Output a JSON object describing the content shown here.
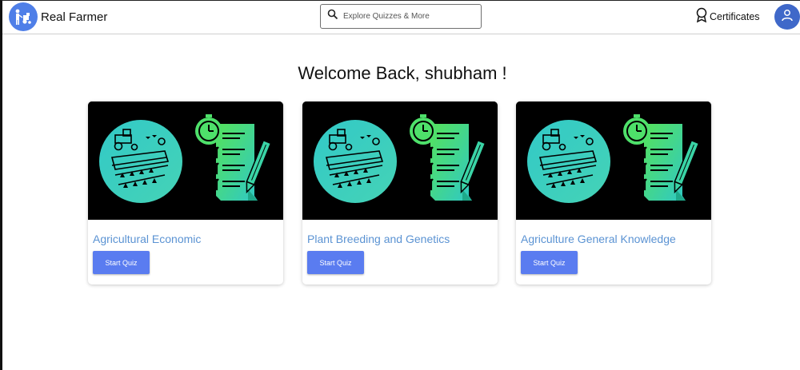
{
  "header": {
    "brand_name": "Real Farmer",
    "search_placeholder": "Explore Quizzes & More",
    "certificates_label": "Certificates"
  },
  "main": {
    "welcome_text": "Welcome Back, shubham !",
    "cards": [
      {
        "title": "Agricultural Economic",
        "button_label": "Start Quiz"
      },
      {
        "title": "Plant Breeding and Genetics",
        "button_label": "Start Quiz"
      },
      {
        "title": "Agriculture General Knowledge",
        "button_label": "Start Quiz"
      }
    ]
  },
  "icons": {
    "logo": "farmer-logo-icon",
    "search": "search-icon",
    "certificates": "award-ribbon-icon",
    "avatar": "user-icon",
    "card_art": "quiz-checklist-illustration"
  },
  "colors": {
    "accent": "#5a7cf0",
    "card_title": "#5b93d3",
    "logo_bg": "#4f7fe8",
    "avatar_bg": "#3f68c9",
    "art_teal": "#3ccfc0",
    "art_green": "#4ee06a"
  }
}
